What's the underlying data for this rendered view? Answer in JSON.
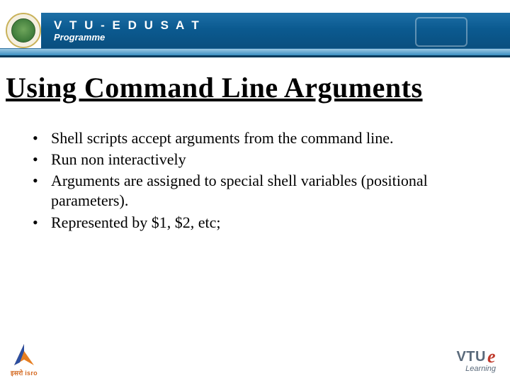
{
  "header": {
    "brand_main": "V T U  -  E D U S A T",
    "brand_sub": "Programme"
  },
  "slide": {
    "heading": "Using Command Line Arguments",
    "bullets": [
      "Shell scripts accept arguments from the command line.",
      "Run non interactively",
      "Arguments are assigned to special shell variables (positional parameters).",
      "Represented by $1, $2, etc;"
    ]
  },
  "footers": {
    "isro_label": "इसरो isro",
    "vtu_brand": "VTU",
    "vtu_e": "e",
    "vtu_sub": "Learning"
  }
}
